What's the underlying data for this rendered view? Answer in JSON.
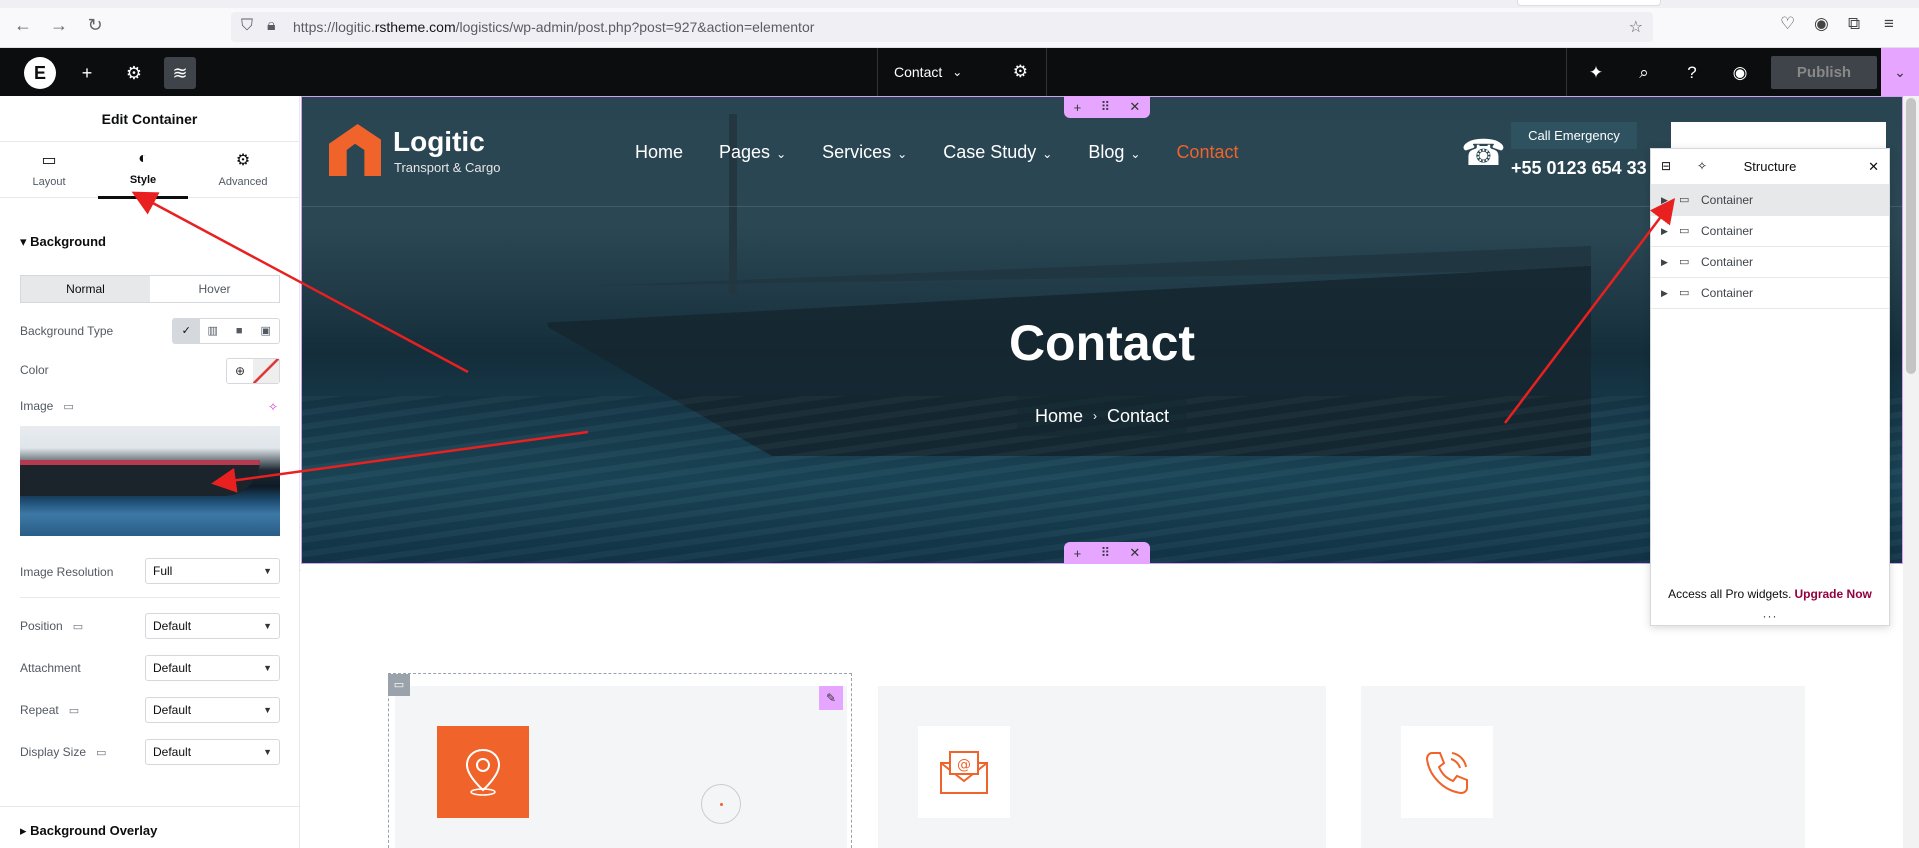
{
  "browser": {
    "url_prefix": "https://logitic.",
    "url_domain": "rstheme.com",
    "url_rest": "/logistics/wp-admin/post.php?post=927&action=elementor"
  },
  "editor": {
    "document_title": "Contact",
    "publish_label": "Publish"
  },
  "panel": {
    "title": "Edit Container",
    "tabs": [
      "Layout",
      "Style",
      "Advanced"
    ],
    "background": {
      "heading": "Background",
      "state_tabs": [
        "Normal",
        "Hover"
      ],
      "type_label": "Background Type",
      "color_label": "Color",
      "image_label": "Image",
      "image_resolution_label": "Image Resolution",
      "image_resolution_value": "Full",
      "position_label": "Position",
      "position_value": "Default",
      "attachment_label": "Attachment",
      "attachment_value": "Default",
      "repeat_label": "Repeat",
      "repeat_value": "Default",
      "display_size_label": "Display Size",
      "display_size_value": "Default"
    },
    "overlay_heading": "Background Overlay"
  },
  "site": {
    "logo_name": "Logitic",
    "logo_tag": "Transport & Cargo",
    "menu": [
      {
        "label": "Home"
      },
      {
        "label": "Pages"
      },
      {
        "label": "Services"
      },
      {
        "label": "Case Study"
      },
      {
        "label": "Blog"
      },
      {
        "label": "Contact"
      }
    ],
    "emergency_label": "Call Emergency",
    "emergency_phone": "+55 0123 654 33",
    "hero_title": "Contact",
    "breadcrumb_home": "Home",
    "breadcrumb_current": "Contact"
  },
  "structure": {
    "title": "Structure",
    "items": [
      "Container",
      "Container",
      "Container",
      "Container"
    ],
    "promo_text": "Access all Pro widgets.",
    "promo_link": "Upgrade Now"
  },
  "colors": {
    "accent": "#f0632b",
    "elementor_pink": "#e6a6ff",
    "annotation_arrow": "#e8201f"
  }
}
